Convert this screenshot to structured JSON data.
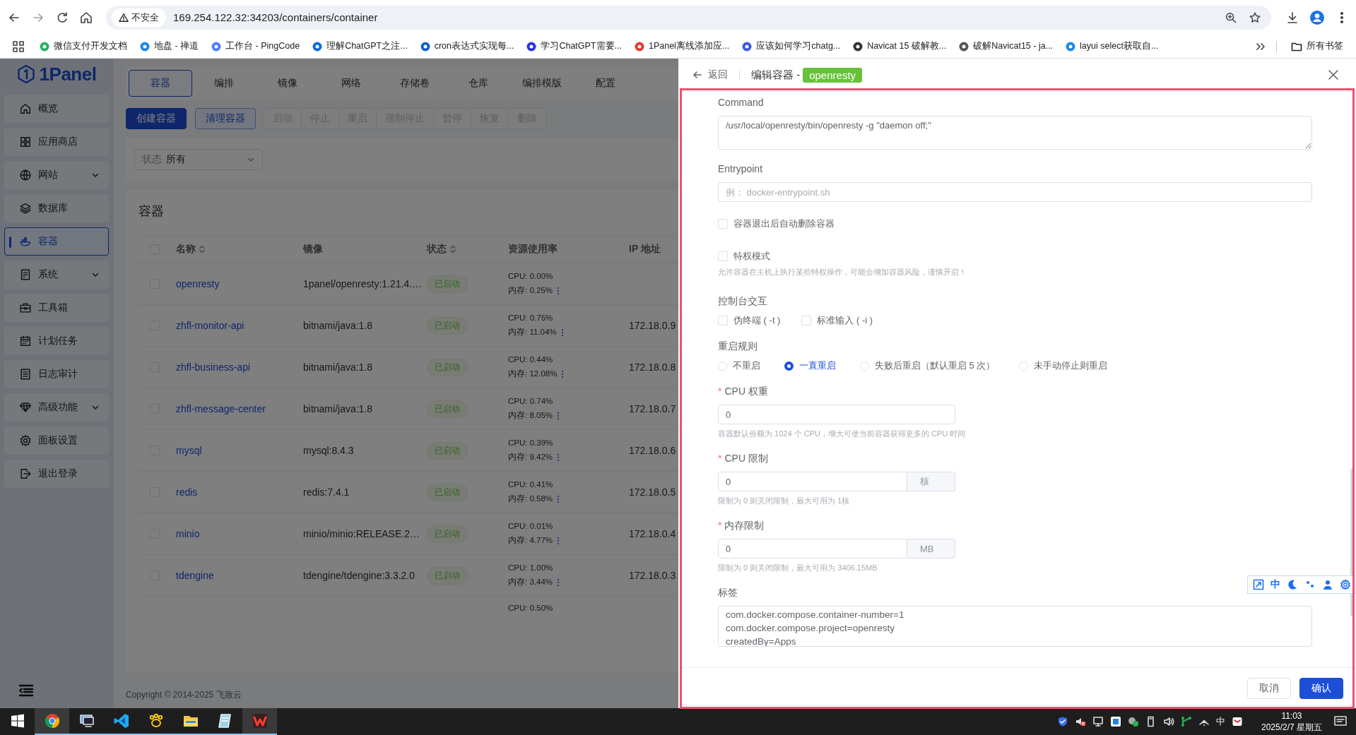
{
  "browser": {
    "security_label": "不安全",
    "url": "169.254.122.32:34203/containers/container",
    "bookmarks": [
      {
        "label": "微信支付开发文档",
        "color": "#2aae67"
      },
      {
        "label": "地盘 - 禅道",
        "color": "#1e88e5"
      },
      {
        "label": "工作台 - PingCode",
        "color": "#4f7cff"
      },
      {
        "label": "理解ChatGPT之注...",
        "color": "#0b6bde"
      },
      {
        "label": "cron表达式实现每...",
        "color": "#1565c0"
      },
      {
        "label": "学习ChatGPT需要...",
        "color": "#2932e1"
      },
      {
        "label": "1Panel离线添加应...",
        "color": "#e53935"
      },
      {
        "label": "应该如何学习chatg...",
        "color": "#3a5bd9"
      },
      {
        "label": "Navicat 15 破解教...",
        "color": "#333333"
      },
      {
        "label": "破解Navicat15 - ja...",
        "color": "#555555"
      },
      {
        "label": "layui select获取自...",
        "color": "#1e88e5"
      }
    ],
    "all_bookmarks": "所有书签"
  },
  "sidebar": {
    "logo": "1Panel",
    "items": [
      {
        "label": "概览",
        "selected": false,
        "expandable": false
      },
      {
        "label": "应用商店",
        "selected": false,
        "expandable": false
      },
      {
        "label": "网站",
        "selected": false,
        "expandable": true
      },
      {
        "label": "数据库",
        "selected": false,
        "expandable": false
      },
      {
        "label": "容器",
        "selected": true,
        "expandable": false
      },
      {
        "label": "系统",
        "selected": false,
        "expandable": true
      },
      {
        "label": "工具箱",
        "selected": false,
        "expandable": false
      },
      {
        "label": "计划任务",
        "selected": false,
        "expandable": false
      },
      {
        "label": "日志审计",
        "selected": false,
        "expandable": false
      },
      {
        "label": "高级功能",
        "selected": false,
        "expandable": true
      },
      {
        "label": "面板设置",
        "selected": false,
        "expandable": false
      },
      {
        "label": "退出登录",
        "selected": false,
        "expandable": false
      }
    ]
  },
  "tabs": [
    {
      "label": "容器",
      "selected": true
    },
    {
      "label": "编排",
      "selected": false
    },
    {
      "label": "镜像",
      "selected": false
    },
    {
      "label": "网络",
      "selected": false
    },
    {
      "label": "存储卷",
      "selected": false
    },
    {
      "label": "仓库",
      "selected": false
    },
    {
      "label": "编排模版",
      "selected": false
    },
    {
      "label": "配置",
      "selected": false
    }
  ],
  "actions": [
    {
      "label": "创建容器",
      "kind": "primary"
    },
    {
      "label": "清理容器",
      "kind": "plain"
    }
  ],
  "batch_actions": [
    {
      "label": "启动",
      "disabled": true
    },
    {
      "label": "停止",
      "disabled": true
    },
    {
      "label": "重启",
      "disabled": true
    },
    {
      "label": "强制停止",
      "disabled": true
    },
    {
      "label": "暂停",
      "disabled": true
    },
    {
      "label": "恢复",
      "disabled": true
    },
    {
      "label": "删除",
      "disabled": true
    }
  ],
  "filter": {
    "label": "状态",
    "value": "所有"
  },
  "table": {
    "title": "容器",
    "select_all_checked": false,
    "columns": [
      {
        "label": "名称",
        "sortable": true
      },
      {
        "label": "镜像",
        "sortable": false
      },
      {
        "label": "状态",
        "sortable": true
      },
      {
        "label": "资源使用率",
        "sortable": false
      },
      {
        "label": "IP 地址",
        "sortable": false
      }
    ],
    "rows": [
      {
        "checked": false,
        "name": "openresty",
        "image": "1panel/openresty:1.21.4.…",
        "status": "已启动",
        "cpu": "CPU: 0.00%",
        "memory": "内存: 0.25%"
      },
      {
        "checked": false,
        "name": "zhfl-monitor-api",
        "image": "bitnami/java:1.8",
        "status": "已启动",
        "cpu": "CPU: 0.75%",
        "memory": "内存: 11.04%",
        "ip": "172.18.0.9"
      },
      {
        "checked": false,
        "name": "zhfl-business-api",
        "image": "bitnami/java:1.8",
        "status": "已启动",
        "cpu": "CPU: 0.44%",
        "memory": "内存: 12.08%",
        "ip": "172.18.0.8"
      },
      {
        "checked": false,
        "name": "zhfl-message-center",
        "image": "bitnami/java:1.8",
        "status": "已启动",
        "cpu": "CPU: 0.74%",
        "memory": "内存: 8.05%",
        "ip": "172.18.0.7"
      },
      {
        "checked": false,
        "name": "mysql",
        "image": "mysql:8.4.3",
        "status": "已启动",
        "cpu": "CPU: 0.39%",
        "memory": "内存: 9.42%",
        "ip": "172.18.0.6"
      },
      {
        "checked": false,
        "name": "redis",
        "image": "redis:7.4.1",
        "status": "已启动",
        "cpu": "CPU: 0.41%",
        "memory": "内存: 0.58%",
        "ip": "172.18.0.5"
      },
      {
        "checked": false,
        "name": "minio",
        "image": "minio/minio:RELEASE.2…",
        "status": "已启动",
        "cpu": "CPU: 0.01%",
        "memory": "内存: 4.77%",
        "ip": "172.18.0.4"
      },
      {
        "checked": false,
        "name": "tdengine",
        "image": "tdengine/tdengine:3.3.2.0",
        "status": "已启动",
        "cpu": "CPU: 1.00%",
        "memory": "内存: 3.44%",
        "ip": "172.18.0.3"
      },
      {
        "cpu": "CPU: 0.50%"
      }
    ]
  },
  "footer": "Copyright © 2014-2025 飞致云",
  "drawer": {
    "back": "返回",
    "title": "编辑容器 -",
    "tag": "openresty",
    "fields": [
      {
        "kind": "textarea",
        "label": "Command",
        "value": "/usr/local/openresty/bin/openresty -g \"daemon off;\""
      },
      {
        "kind": "input",
        "label": "Entrypoint",
        "placeholder": "例： docker-entrypoint.sh"
      },
      {
        "kind": "checkbox",
        "label": "容器退出后自动删除容器",
        "checked": false
      },
      {
        "kind": "checkbox",
        "label": "特权模式",
        "checked": false,
        "help": "允许容器在主机上执行某些特权操作，可能会增加容器风险，谨慎开启！"
      },
      {
        "kind": "checkbox-group",
        "label": "控制台交互",
        "options": [
          {
            "label": "伪终端 ( -t )",
            "checked": false
          },
          {
            "label": "标准输入 ( -i )",
            "checked": false
          }
        ]
      },
      {
        "kind": "radio-group",
        "label": "重启规则",
        "options": [
          {
            "label": "不重启",
            "selected": false
          },
          {
            "label": "一直重启",
            "selected": true
          },
          {
            "label": "失败后重启（默认重启 5 次）",
            "selected": false
          },
          {
            "label": "未手动停止则重启",
            "selected": false
          }
        ]
      },
      {
        "kind": "number",
        "label": "CPU 权重",
        "marker": "*",
        "value": "0",
        "help": "容器默认份额为 1024 个 CPU，增大可使当前容器获得更多的 CPU 时间"
      },
      {
        "kind": "number",
        "label": "CPU 限制",
        "marker": "*",
        "value": "0",
        "suffix": "核",
        "help": "限制为 0 则关闭限制，最大可用为 1核"
      },
      {
        "kind": "number",
        "label": "内存限制",
        "marker": "*",
        "value": "0",
        "suffix": "MB",
        "help": "限制为 0 则关闭限制，最大可用为 3406.15MB"
      },
      {
        "kind": "textarea",
        "label": "标签",
        "value": "com.docker.compose.container-number=1\ncom.docker.compose.project=openresty\ncreatedBy=Apps"
      }
    ],
    "buttons": [
      {
        "label": "取消",
        "kind": "default"
      },
      {
        "label": "确认",
        "kind": "primary"
      }
    ]
  },
  "extension_toolbar": {
    "language": "中"
  },
  "taskbar": {
    "ime": "中",
    "time": "11:03",
    "date": "2025/2/7 星期五"
  }
}
